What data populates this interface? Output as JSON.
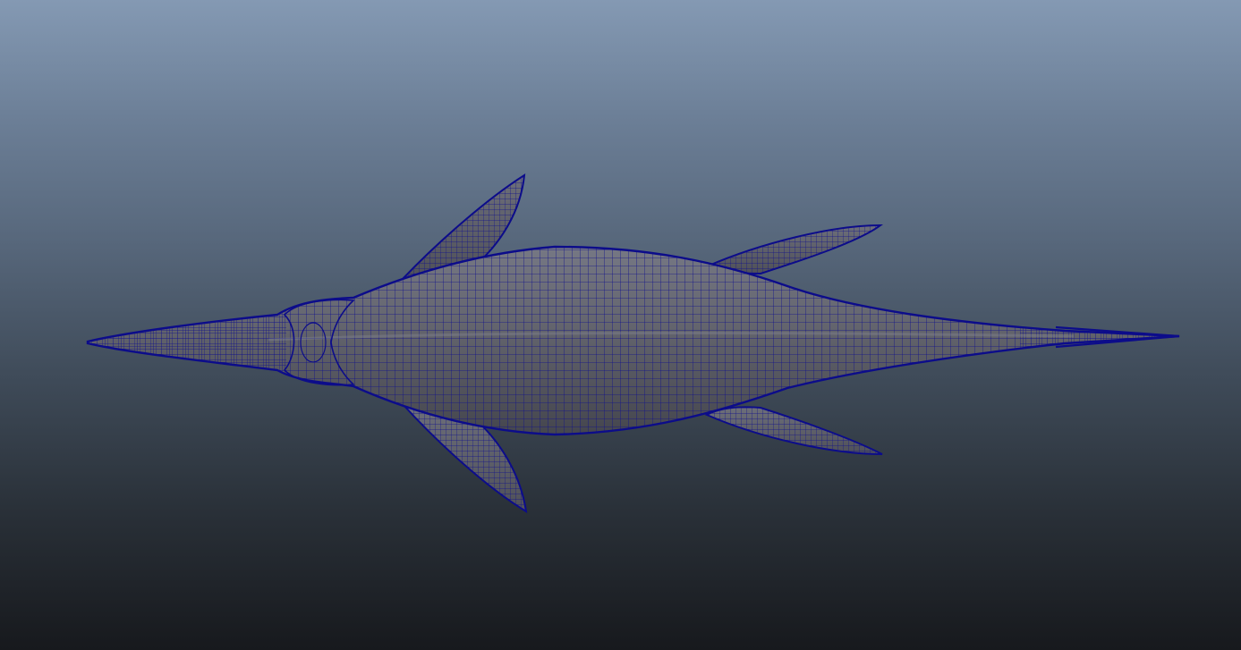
{
  "viewport": {
    "background_top": "#8499b3",
    "background_bottom": "#17191d"
  },
  "model": {
    "object_type": "plesiosaur-mesh",
    "display_mode": "wireframe-on-shaded",
    "surface_color": "#5f6069",
    "wireframe_color": "#0c0c8a"
  }
}
